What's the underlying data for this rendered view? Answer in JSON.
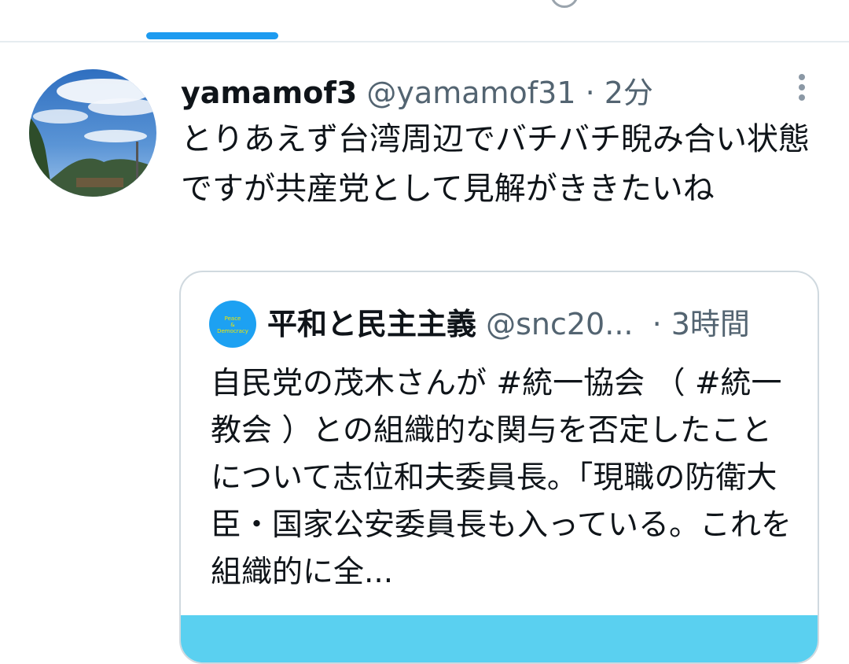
{
  "colors": {
    "accent": "#1d9bf0",
    "media_preview": "#5ad0f0"
  },
  "icons": {
    "tab_partial": "search-icon",
    "more": "more-vertical-icon"
  },
  "tweet": {
    "author_name": "yamamof3",
    "handle": "@yamamof31",
    "separator": " · ",
    "time": "2分",
    "text": "とりあえず台湾周辺でバチバチ睨み合い状態ですが共産党として見解がききたいね"
  },
  "quote": {
    "author_name": "平和と民主主義",
    "handle": "@snc20...",
    "time": "· 3時間",
    "avatar_text": [
      "Peace",
      "&",
      "Democracy"
    ],
    "text": "自民党の茂木さんが #統一協会 （ #統一教会 ）との組織的な関与を否定したことについて志位和夫委員長。「現職の防衛大臣・国家公安委員長も入っている。これを組織的に全..."
  }
}
